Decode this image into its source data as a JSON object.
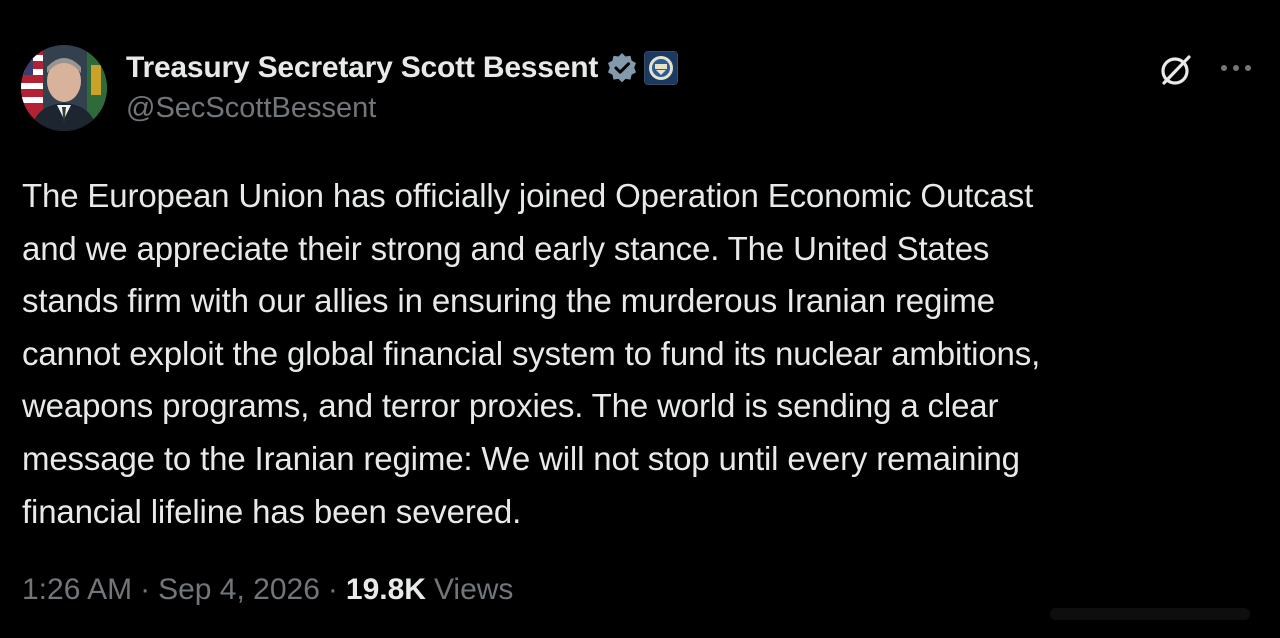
{
  "author": {
    "display_name": "Treasury Secretary Scott Bessent",
    "handle": "@SecScottBessent",
    "avatar_icon": "portrait-avatar",
    "verified_icon": "verified-badge-icon",
    "affiliate_icon": "treasury-seal-icon"
  },
  "actions": {
    "grok_icon": "grok-icon",
    "more_icon": "more-options-icon"
  },
  "tweet": {
    "lines": [
      "The European Union has officially joined Operation Economic Outcast",
      "and we appreciate their strong and early stance. The United States",
      "stands firm with our allies in ensuring the murderous Iranian regime",
      "cannot exploit the global financial system to fund its nuclear ambitions,",
      "weapons programs, and terror proxies. The world is sending a clear",
      "message to the Iranian regime: We will not stop until every remaining",
      "financial lifeline has been severed."
    ]
  },
  "meta": {
    "time": "1:26 AM",
    "separator": "·",
    "date": "Sep 4, 2026",
    "views_count": "19.8K",
    "views_label": "Views"
  },
  "colors": {
    "background": "#000000",
    "primary_text": "#e7e9ea",
    "secondary_text": "#71767b",
    "verified_blue": "#829aab"
  }
}
